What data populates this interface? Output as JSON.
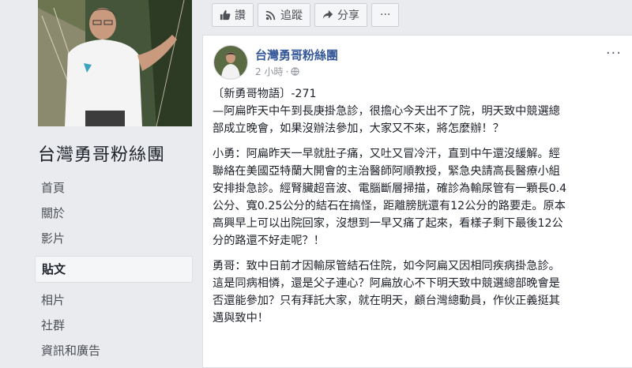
{
  "page": {
    "name": "台灣勇哥粉絲團"
  },
  "nav": {
    "items": [
      {
        "label": "首頁"
      },
      {
        "label": "關於"
      },
      {
        "label": "影片"
      },
      {
        "label": "貼文"
      },
      {
        "label": "相片"
      },
      {
        "label": "社群"
      },
      {
        "label": "資訊和廣告"
      }
    ],
    "active_index": 3
  },
  "actions": {
    "like_label": "讚",
    "follow_label": "追蹤",
    "share_label": "分享",
    "more_label": "···"
  },
  "post": {
    "author": "台灣勇哥粉絲團",
    "time": "2 小時",
    "options_label": "···",
    "lines": [
      "〔新勇哥物語〕-271",
      "—阿扁昨天中午到長庚掛急診，很擔心今天出不了院，明天致中競選總",
      "部成立晚會，如果沒辦法參加，大家又不來，將怎麼辦！？"
    ],
    "paragraph2": [
      "小勇：阿扁昨天一早就肚子痛，又吐又冒冷汗，直到中午還沒緩解。經",
      "聯絡在美國亞特蘭大開會的主治醫師阿順教授，緊急央請高長醫療小組",
      "安排掛急診。經腎臟超音波、電腦斷層掃描，確診為輸尿管有一顆長0.4",
      "公分、寬0.25公分的結石在搞怪，距離膀胱還有12公分的路要走。原本",
      "高興早上可以出院回家，沒想到一早又痛了起來，看樣子剩下最後12公",
      "分的路還不好走呢？！"
    ],
    "paragraph3": [
      "勇哥：致中日前才因輸尿管結石住院，如今阿扁又因相同疾病掛急診。",
      "這是同病相憐，還是父子連心？阿扁放心不下明天致中競選總部晚會是",
      "否還能參加？只有拜託大家，就在明天，顧台灣總動員，作伙正義挺其",
      "邁與致中！"
    ]
  },
  "colors": {
    "link": "#365899",
    "background": "#e9ebee"
  },
  "icons": {
    "like": "thumbs-up-icon",
    "follow": "rss-icon",
    "share": "share-arrow-icon",
    "globe": "globe-icon"
  }
}
